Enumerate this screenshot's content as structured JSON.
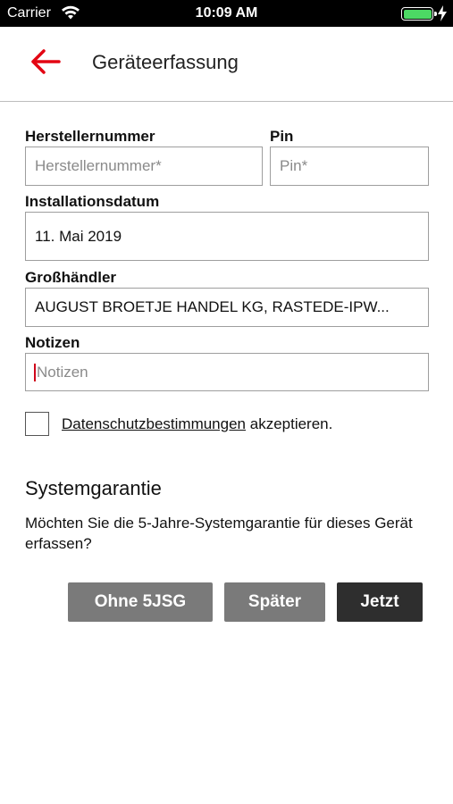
{
  "status_bar": {
    "carrier": "Carrier",
    "time": "10:09 AM",
    "battery_level": 1.0,
    "battery_color": "#4cd964",
    "charging": true
  },
  "nav": {
    "back_icon": "arrow-left-icon",
    "title": "Geräteerfassung",
    "accent_color": "#e30613"
  },
  "form": {
    "manufacturer_number": {
      "label": "Herstellernummer",
      "value": "",
      "placeholder": "Herstellernummer*"
    },
    "pin": {
      "label": "Pin",
      "value": "",
      "placeholder": "Pin*"
    },
    "installation_date": {
      "label": "Installationsdatum",
      "value": "11. Mai 2019"
    },
    "wholesaler": {
      "label": "Großhändler",
      "value": "AUGUST BROETJE HANDEL KG, RASTEDE-IPW..."
    },
    "notes": {
      "label": "Notizen",
      "value": "",
      "placeholder": "Notizen"
    },
    "privacy": {
      "checked": false,
      "link_text": "Datenschutzbestimmungen",
      "suffix_text": " akzeptieren."
    }
  },
  "warranty": {
    "title": "Systemgarantie",
    "text": "Möchten Sie die 5-Jahre-Systemgarantie für dieses Gerät erfassen?",
    "buttons": {
      "without": "Ohne 5JSG",
      "later": "Später",
      "now": "Jetzt"
    }
  }
}
